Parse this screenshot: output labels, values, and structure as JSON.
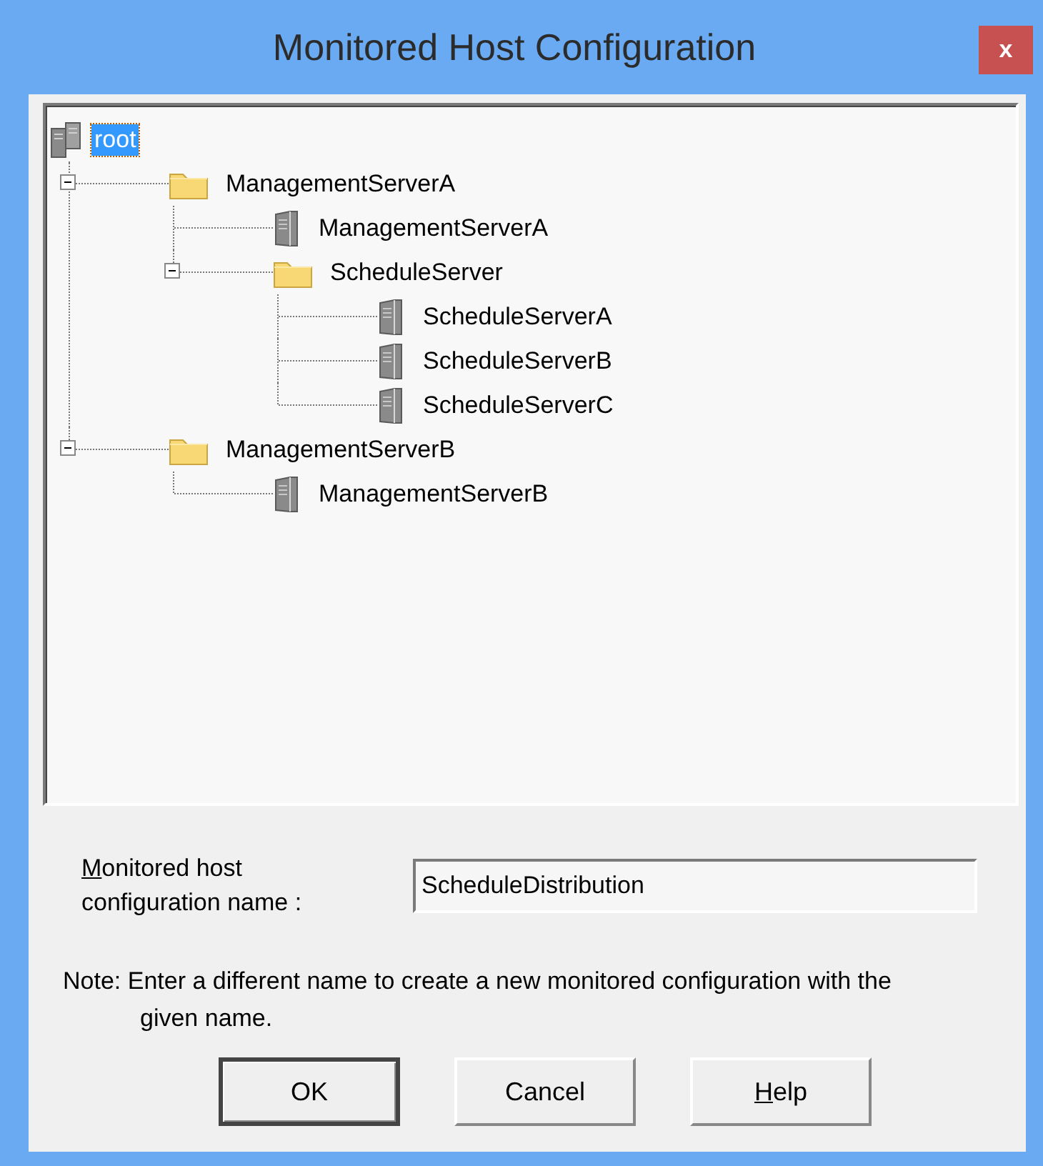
{
  "window": {
    "title": "Monitored Host Configuration",
    "close_label": "x"
  },
  "tree": {
    "label": "root",
    "kind": "hosts",
    "selected": true,
    "children": [
      {
        "label": "ManagementServerA",
        "kind": "folder",
        "selected": false,
        "expanded": true,
        "children": [
          {
            "label": "ManagementServerA",
            "kind": "server",
            "selected": false
          },
          {
            "label": "ScheduleServer",
            "kind": "folder",
            "selected": false,
            "expanded": true,
            "children": [
              {
                "label": "ScheduleServerA",
                "kind": "server",
                "selected": false
              },
              {
                "label": "ScheduleServerB",
                "kind": "server",
                "selected": false
              },
              {
                "label": "ScheduleServerC",
                "kind": "server",
                "selected": false
              }
            ]
          }
        ]
      },
      {
        "label": "ManagementServerB",
        "kind": "folder",
        "selected": false,
        "expanded": true,
        "children": [
          {
            "label": "ManagementServerB",
            "kind": "server",
            "selected": false
          }
        ]
      }
    ]
  },
  "name_field": {
    "label": "Monitored host configuration name :",
    "mnemonic": true,
    "value": "ScheduleDistribution"
  },
  "note": "Note: Enter a different name to create a new monitored configuration with the given name.",
  "buttons": [
    {
      "label": "OK",
      "default": true,
      "mnemonic": false
    },
    {
      "label": "Cancel",
      "default": false,
      "mnemonic": false
    },
    {
      "label": "Help",
      "default": false,
      "mnemonic": true
    }
  ]
}
